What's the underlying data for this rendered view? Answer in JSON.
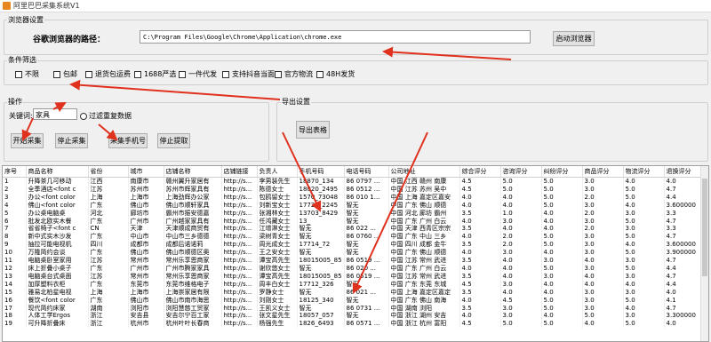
{
  "window": {
    "title": "阿里巴巴采集系统V1"
  },
  "browser_settings": {
    "group_label": "浏览器设置",
    "path_label": "谷歌浏览器的路径：",
    "path_value": "C:\\Program Files\\Google\\Chrome\\Application\\chrome.exe",
    "launch_button": "启动浏览器"
  },
  "filters": {
    "group_label": "条件筛选",
    "options": [
      "不限",
      "包邮",
      "退货包运费",
      "1688严选",
      "一件代发",
      "支持抖音当面",
      "官方物流",
      "48H发货"
    ]
  },
  "operations": {
    "group_label": "操作",
    "keyword_label": "关键词:",
    "keyword_value": "家具",
    "dedupe_label": "过滤重复数据",
    "start_button": "开始采集",
    "stop_button": "停止采集",
    "collect_phone_button": "采集手机号",
    "stop_extract_button": "停止提取"
  },
  "export": {
    "group_label": "导出设置",
    "export_button": "导出表格"
  },
  "table": {
    "columns": [
      "序号",
      "商品名称",
      "省份",
      "城市",
      "店铺名称",
      "店铺链接",
      "负责人",
      "手机号码",
      "电话号码",
      "公司地址",
      "综合评分",
      "咨询评分",
      "纠纷评分",
      "商品评分",
      "物流评分",
      "退换评分"
    ],
    "rows": [
      [
        "1",
        "升降茶几可移动",
        "江西",
        "南康市",
        "赣州翼升家居有",
        "http://s...",
        "李男装先生",
        "18870_134",
        "86 0797 ...",
        "中国 江西 赣州 南康",
        "4.5",
        "5.0",
        "5.0",
        "3.0",
        "4.0",
        "4.0"
      ],
      [
        "2",
        "全季酒店<font c",
        "江苏",
        "苏州市",
        "苏州市辉家具有",
        "http://s...",
        "陈德女士",
        "18020_2495",
        "86 0512 ...",
        "中国 江苏 苏州 吴中",
        "4.5",
        "5.0",
        "5.0",
        "3.0",
        "5.0",
        "4.7"
      ],
      [
        "3",
        "办公<font color",
        "上海",
        "上海市",
        "上海劲辉办公家",
        "http://s...",
        "包鸥留女士",
        "1570_73048",
        "86 010 1...",
        "中国 上海 嘉定区嘉安",
        "4.0",
        "4.0",
        "5.0",
        "2.0",
        "5.0",
        "4.4"
      ],
      [
        "4",
        "佛山<font color",
        "广东",
        "佛山市",
        "佛山市顺轩家具",
        "http://s...",
        "刘新宝女士",
        "17727_2245",
        "智无",
        "中国 广东 佛山 顺德",
        "4.0",
        "4.0",
        "5.0",
        "3.0",
        "4.0",
        "3.600000"
      ],
      [
        "5",
        "办公桌电脑桌",
        "河北",
        "廊坊市",
        "霸州市振安德嘉",
        "http://s...",
        "张湘林女士",
        "13703_8429",
        "智无",
        "中国 河北 廊坊 霸州",
        "3.5",
        "1.0",
        "4.0",
        "2.0",
        "3.0",
        "3.3"
      ],
      [
        "6",
        "批发北欧实木餐",
        "广东",
        "广州市",
        "广州越家家具有",
        "http://s...",
        "任鸿藏女士",
        "13_",
        "智无",
        "中国 广东 广州 白云",
        "4.0",
        "3.0",
        "4.0",
        "3.0",
        "5.0",
        "4.7"
      ],
      [
        "7",
        "省省椅子<font c",
        "CN",
        "天津",
        "天津顺成商贸有",
        "http://s...",
        "江增淋女士",
        "智无",
        "86 022 ...",
        "中国 天津 西青区宗宗",
        "3.5",
        "4.0",
        "4.0",
        "2.0",
        "3.0",
        "3.3"
      ],
      [
        "8",
        "新中式实木沙发",
        "广东",
        "中山市",
        "中山市三乡德德",
        "http://s...",
        "梁树青女士",
        "智无",
        "86 0760 ...",
        "中国 广东 中山 三乡",
        "4.0",
        "2.0",
        "5.0",
        "3.0",
        "5.0",
        "4.7"
      ],
      [
        "9",
        "抽拉可能电视机",
        "四川",
        "成都市",
        "成都后诺诺莉",
        "http://s...",
        "周光成女士",
        "17714_72",
        "智无",
        "中国 四川 成都 金牛",
        "3.5",
        "2.0",
        "5.0",
        "3.0",
        "4.0",
        "3.600000"
      ],
      [
        "10",
        "万隆简约会谈",
        "广东",
        "佛山市",
        "佛山市顺德区奥",
        "http://s...",
        "王之安女士",
        "智无",
        "智无",
        "中国 广东 佛山 顺德",
        "4.0",
        "3.0",
        "4.0",
        "3.0",
        "5.0",
        "3.900000"
      ],
      [
        "11",
        "电脑桌卧室家用",
        "江苏",
        "常州市",
        "常州乐享恩商家",
        "http://s...",
        "谭宝高先生",
        "18015005_85",
        "86 0519 ...",
        "中国 江苏 常州 武进",
        "3.5",
        "4.0",
        "3.0",
        "4.0",
        "3.0",
        "4.7"
      ],
      [
        "12",
        "床上折叠小桌子",
        "广东",
        "广州市",
        "广州市腾家家具",
        "http://s...",
        "谢欣悠女士",
        "智无",
        "86 020 ...",
        "中国 广东 广州 白云",
        "4.0",
        "4.0",
        "5.0",
        "3.0",
        "5.0",
        "4.4"
      ],
      [
        "13",
        "电脑桌台式桌面",
        "江苏",
        "常州市",
        "常州乐享恩商家",
        "http://s...",
        "谭宝高先生",
        "18015005_85",
        "86 0519 ...",
        "中国 江苏 常州 武进",
        "3.5",
        "4.0",
        "3.0",
        "4.0",
        "3.0",
        "4.7"
      ],
      [
        "14",
        "加厚塑料衣柜",
        "广东",
        "东莞市",
        "东莞市维格电子",
        "http://s...",
        "周丰白女士",
        "17712_326",
        "智无",
        "中国 广东 东莞 东城",
        "4.5",
        "3.0",
        "4.0",
        "4.0",
        "4.0",
        "4.4"
      ],
      [
        "15",
        "雅易北柏星电视",
        "上海",
        "上海市",
        "上海崇家居有限",
        "http://s...",
        "罗静女士",
        "智无",
        "86 021 ...",
        "中国 上海 嘉定区嘉定",
        "3.5",
        "4.0",
        "4.0",
        "3.0",
        "3.0",
        "4.0"
      ],
      [
        "16",
        "餐饮<font color",
        "广东",
        "佛山市",
        "佛山市南市海思",
        "http://s...",
        "刘刚女士",
        "18125_340",
        "智无",
        "中国 广东 佛山 南海",
        "4.0",
        "4.5",
        "5.0",
        "3.0",
        "5.0",
        "4.1"
      ],
      [
        "17",
        "现代简约床家",
        "湖南",
        "浏阳市",
        "浏阳慧慈工贸家",
        "http://s...",
        "王凯义女士",
        "智无",
        "86 0731 ...",
        "中国 湖南 浏阳",
        "3.5",
        "3.0",
        "5.0",
        "3.0",
        "4.0",
        "4.7"
      ],
      [
        "18",
        "人体工学Ergos",
        "浙江",
        "安吉县",
        "安吉尔宁百工家",
        "http://s...",
        "张文星先生",
        "18057_057",
        "智无",
        "中国 浙江 湖州 安吉",
        "4.0",
        "3.0",
        "4.0",
        "5.0",
        "3.0",
        "3.300000"
      ],
      [
        "19",
        "可升降折叠床",
        "浙江",
        "杭州市",
        "杭州叶叶长春商",
        "http://s...",
        "杨强先生",
        "1826_6493",
        "86 0571 ...",
        "中国 浙江 杭州 富阳",
        "4.5",
        "5.0",
        "5.0",
        "4.0",
        "5.0",
        "4.0"
      ]
    ]
  }
}
